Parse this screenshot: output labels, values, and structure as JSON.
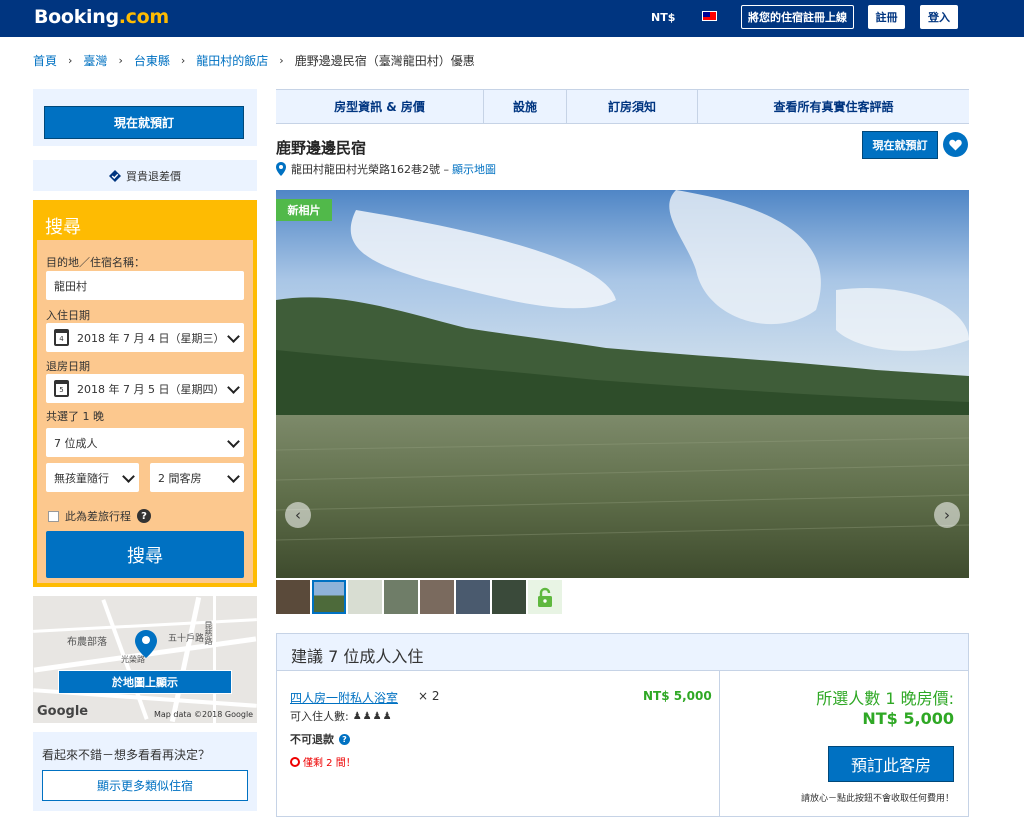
{
  "header": {
    "logo_main": "Booking",
    "logo_suffix": ".com",
    "currency": "NT$",
    "list_property": "將您的住宿註冊上線",
    "register": "註冊",
    "login": "登入"
  },
  "breadcrumb": {
    "items": [
      "首頁",
      "臺灣",
      "台東縣",
      "龍田村的飯店",
      "鹿野邊邊民宿（臺灣龍田村）優惠"
    ],
    "separator": "›"
  },
  "sidebar": {
    "book_now": "現在就預訂",
    "price_match": "買貴退差價",
    "search": {
      "title": "搜尋",
      "destination_label": "目的地／住宿名稱：",
      "destination_value": "龍田村",
      "checkin_label": "入住日期",
      "checkin_day": "4",
      "checkin_value": "2018 年 7 月 4 日（星期三）",
      "checkout_label": "退房日期",
      "checkout_day": "5",
      "checkout_value": "2018 年 7 月 5 日（星期四）",
      "nights": "共選了 1 晚",
      "adults": "7 位成人",
      "children": "無孩童隨行",
      "rooms": "2 間客房",
      "business_trip": "此為差旅行程",
      "help": "?",
      "button": "搜尋"
    },
    "map": {
      "labels": [
        "布農部落",
        "五十戶路",
        "光榮路",
        "昆慈路"
      ],
      "show_on_map": "於地圖上顯示",
      "google": "Google",
      "attribution": "Map data ©2018 Google"
    },
    "similar": {
      "text": "看起來不錯－想多看看再決定？",
      "button": "顯示更多類似住宿"
    }
  },
  "main": {
    "tabs": [
      "房型資訊 & 房價",
      "設施",
      "訂房須知",
      "查看所有真實住客評語"
    ],
    "hotel_name": "鹿野邊邊民宿",
    "address": "龍田村龍田村光榮路162巷2號 –",
    "show_map": "顯示地圖",
    "reserve": "現在就預訂",
    "photo_badge": "新相片",
    "prev_arrow": "‹",
    "next_arrow": "›",
    "recommendation": {
      "title": "建議 7 位成人入住",
      "room_name": "四人房一附私人浴室",
      "room_qty": "× 2",
      "room_price": "NT$ 5,000",
      "occupancy_label": "可入住人數:",
      "occupancy_icons": "♟♟♟♟",
      "non_refundable": "不可退款",
      "help": "?",
      "left_only": "僅剩 2 間！",
      "total_label": "所選人數 1 晚房價:",
      "total_price": "NT$ 5,000",
      "book_button": "預訂此客房",
      "book_note": "請放心－點此按鈕不會收取任何費用！"
    }
  },
  "colors": {
    "brand_blue": "#003580",
    "action_blue": "#0071c2",
    "search_yellow": "#febb02",
    "price_green": "#2fa825"
  }
}
